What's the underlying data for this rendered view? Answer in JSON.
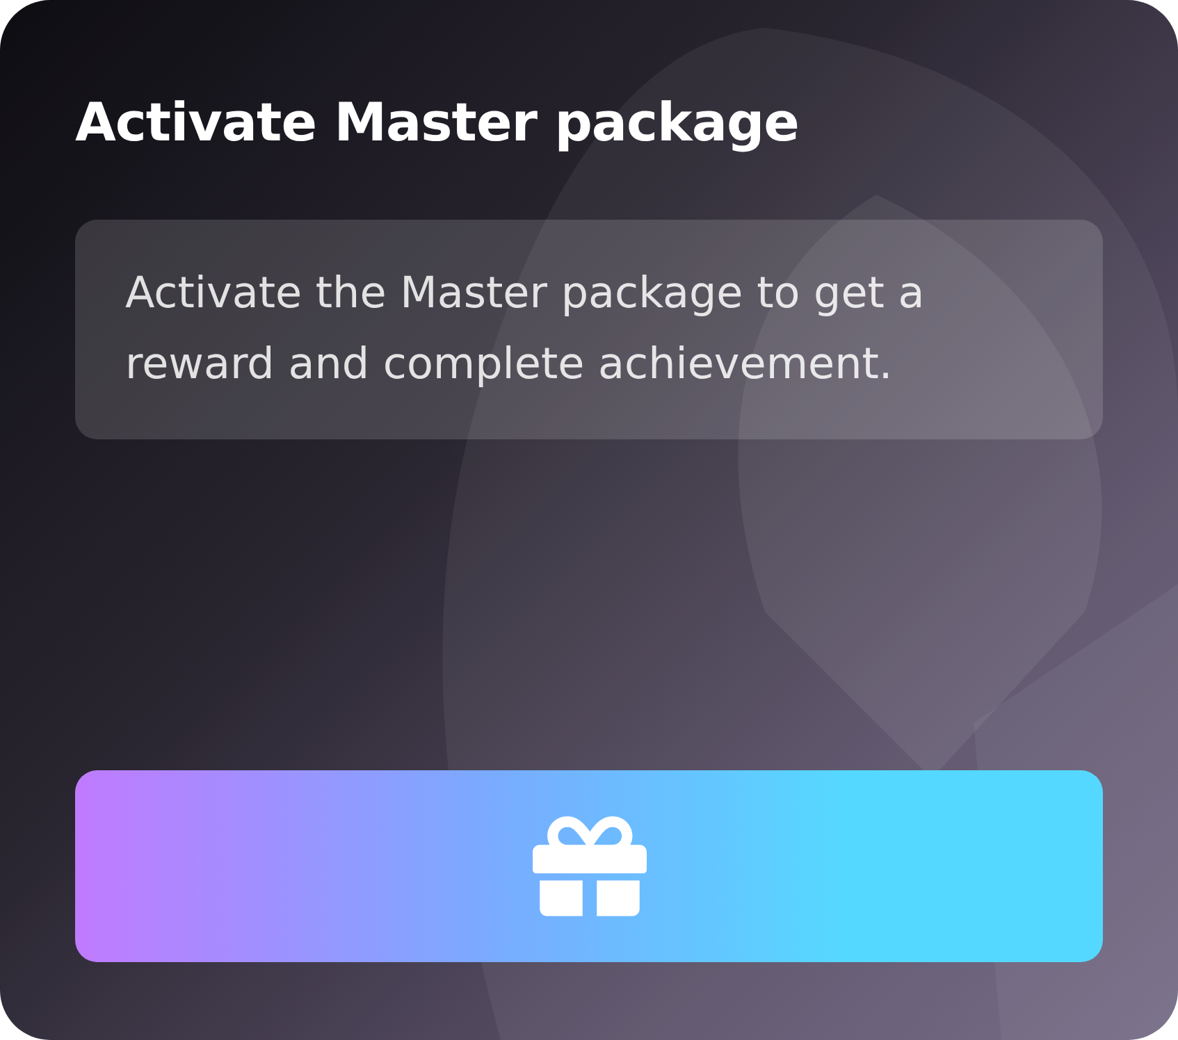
{
  "title": "Activate Master package",
  "description": "Activate the Master package to get a reward and complete achievement."
}
